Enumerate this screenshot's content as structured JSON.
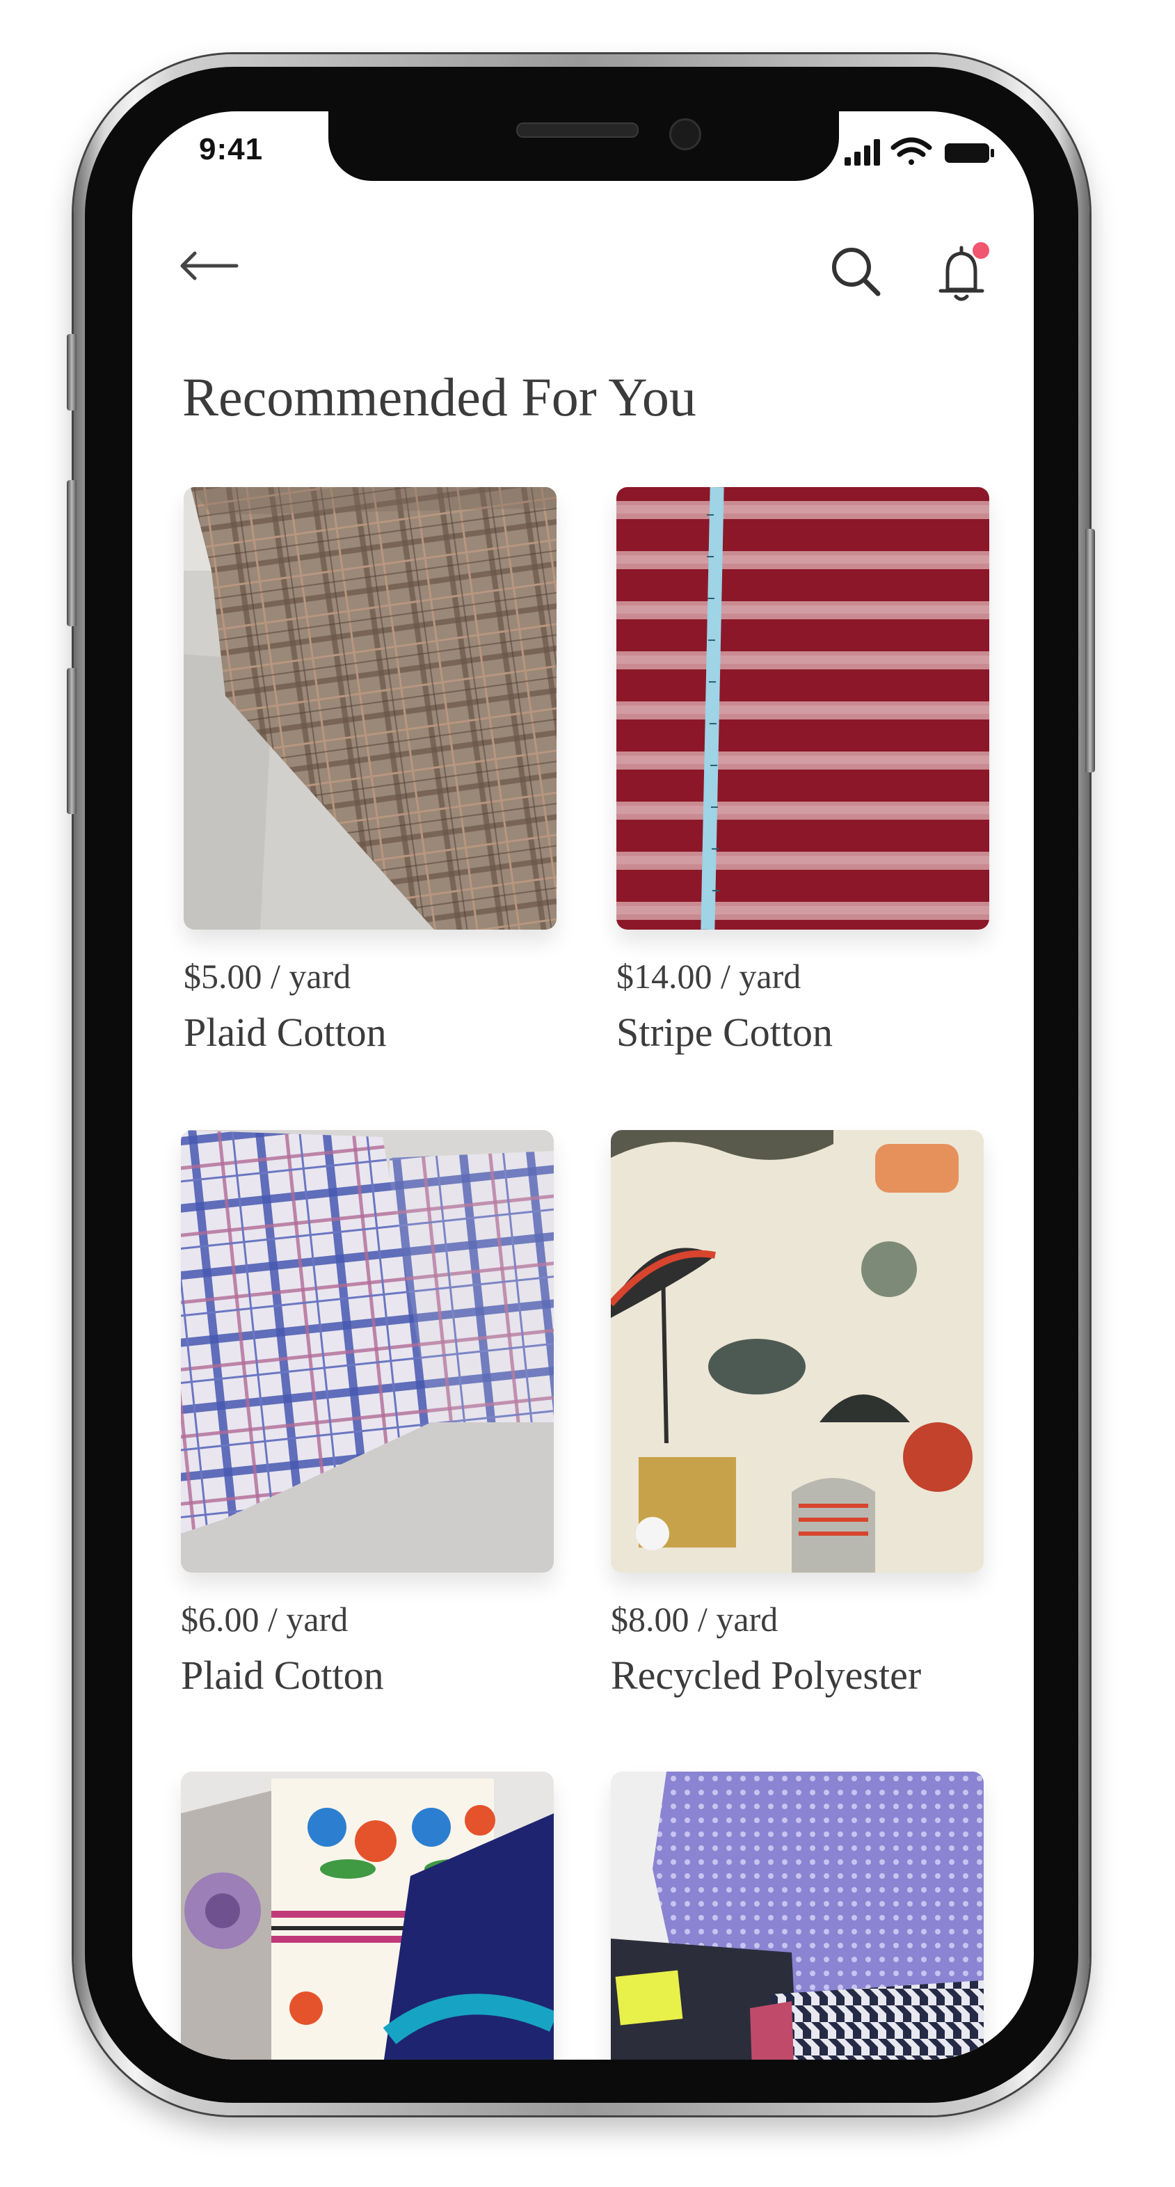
{
  "status_bar": {
    "time": "9:41",
    "icons": [
      "cellular-signal-icon",
      "wifi-icon",
      "battery-icon"
    ]
  },
  "header": {
    "back_icon": "arrow-left-icon",
    "search_icon": "search-icon",
    "notification_icon": "bell-icon",
    "notification_dot_color": "#f2556e"
  },
  "page": {
    "title": "Recommended For You"
  },
  "products": [
    {
      "price": "$5.00 / yard",
      "name": "Plaid Cotton"
    },
    {
      "price": "$14.00 / yard",
      "name": "Stripe Cotton"
    },
    {
      "price": "$6.00 / yard",
      "name": "Plaid Cotton"
    },
    {
      "price": "$8.00 / yard",
      "name": "Recycled Polyester"
    }
  ],
  "colors": {
    "text": "#3b3b3b",
    "background": "#ffffff",
    "frame": "#0b0b0b"
  }
}
